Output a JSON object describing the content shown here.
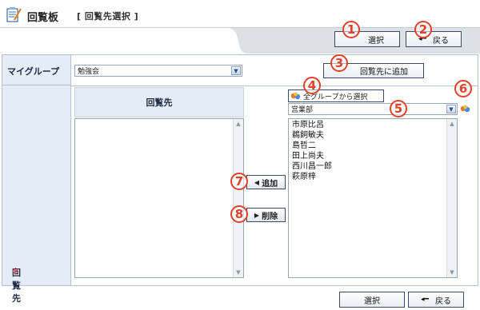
{
  "header": {
    "app_title": "回覧板",
    "page_subtitle": "[ 回覧先選択 ]"
  },
  "toolbar": {
    "select_label": "選択",
    "back_label": "戻る"
  },
  "form": {
    "mygroup_label": "マイグループ",
    "mygroup_value": "勉強会",
    "add_to_recipients_label": "回覧先に追加",
    "recipients_label": "回覧先",
    "required_mark": "※",
    "recipients_column_header": "回覧先",
    "select_from_all_groups_label": "全グループから選択",
    "group_value": "営業部",
    "members": [
      "市原比呂",
      "鵜飼敏夫",
      "島哲二",
      "田上尚夫",
      "西川昌一郎",
      "萩原梓"
    ],
    "add_label": "追加",
    "delete_label": "削除"
  },
  "footer": {
    "select_label": "選択",
    "back_label": "戻る"
  },
  "markers": [
    "1",
    "2",
    "3",
    "4",
    "5",
    "6",
    "7",
    "8"
  ],
  "colors": {
    "marker": "#e2402b",
    "label_bg": "#e4ecf6",
    "border": "#b4c0d4",
    "required": "#e53935"
  },
  "icons": {
    "app": "notepad-pencil-icon",
    "back": "back-arrow-icon",
    "dropdown": "chevron-down-icon",
    "group": "group-people-icon",
    "add": "left-triangle-icon",
    "delete": "right-triangle-icon"
  }
}
